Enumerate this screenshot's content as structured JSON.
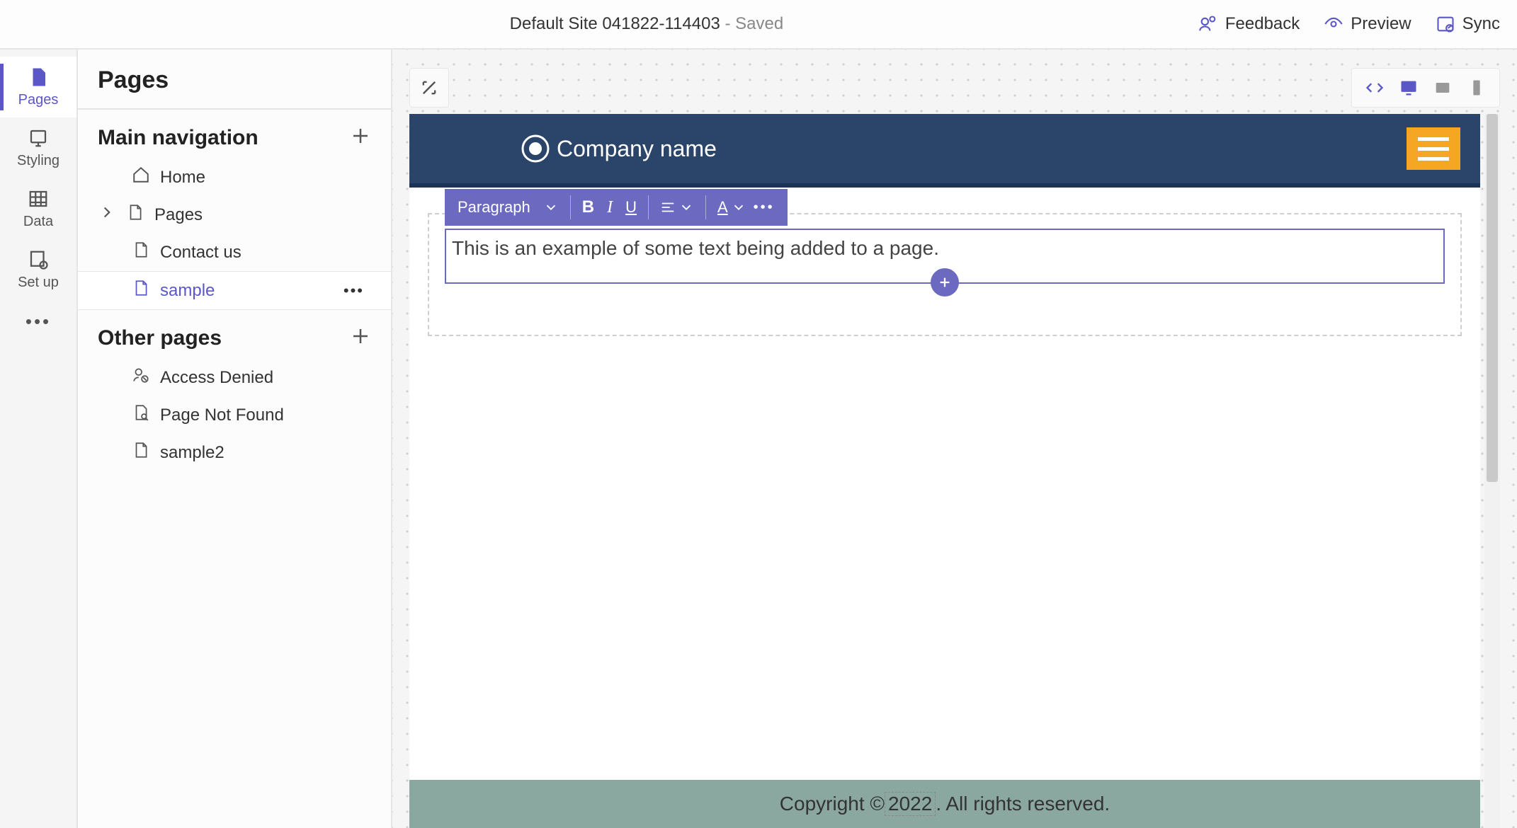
{
  "topbar": {
    "site_name": "Default Site 041822-114403",
    "saved_suffix": " - Saved",
    "feedback": "Feedback",
    "preview": "Preview",
    "sync": "Sync"
  },
  "rail": {
    "pages": "Pages",
    "styling": "Styling",
    "data": "Data",
    "setup": "Set up"
  },
  "panel": {
    "title": "Pages",
    "sections": {
      "main_nav": "Main navigation",
      "other": "Other pages"
    },
    "main_nav_items": {
      "home": "Home",
      "pages": "Pages",
      "contact": "Contact us",
      "sample": "sample"
    },
    "other_items": {
      "access_denied": "Access Denied",
      "not_found": "Page Not Found",
      "sample2": "sample2"
    }
  },
  "editor": {
    "paragraph": "Paragraph",
    "sample_text": "This is an example of some text being added to a page."
  },
  "site": {
    "brand": "Company name",
    "footer_prefix": "Copyright © ",
    "footer_year": "2022",
    "footer_suffix": ". All rights reserved."
  }
}
